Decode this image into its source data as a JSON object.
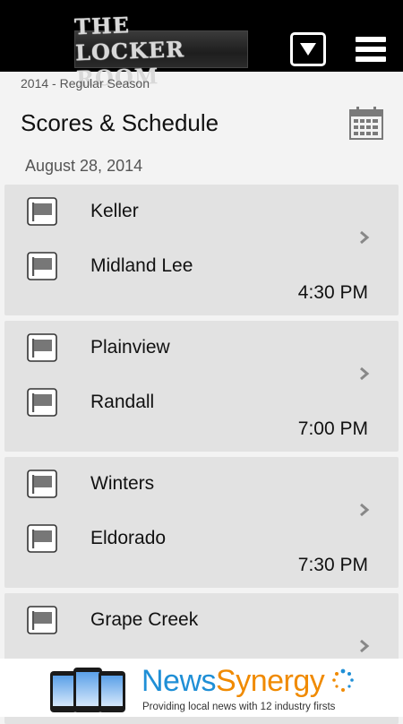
{
  "app": {
    "logo_text": "THE LOCKER ROOM",
    "season_label": "2014 - Regular Season",
    "page_title": "Scores & Schedule"
  },
  "schedule": {
    "date": "August 28, 2014",
    "games": [
      {
        "team1": "Keller",
        "team2": "Midland Lee",
        "time": "4:30 PM"
      },
      {
        "team1": "Plainview",
        "team2": "Randall",
        "time": "7:00 PM"
      },
      {
        "team1": "Winters",
        "team2": "Eldorado",
        "time": "7:30 PM"
      },
      {
        "team1": "Grape Creek",
        "team2": "",
        "time": ""
      }
    ]
  },
  "ad": {
    "brand_part1": "News",
    "brand_part2": "Synergy",
    "tagline": "Providing local news with 12 industry firsts"
  },
  "colors": {
    "bar": "#000000",
    "background": "#f3f3f3",
    "card": "#e2e2e2",
    "icon": "#7a7a7a",
    "brand_blue": "#1f8fd6",
    "brand_orange": "#f08a00"
  },
  "icons": [
    "dropdown-icon",
    "menu-icon",
    "calendar-icon",
    "flag-icon",
    "chevron-right-icon"
  ]
}
